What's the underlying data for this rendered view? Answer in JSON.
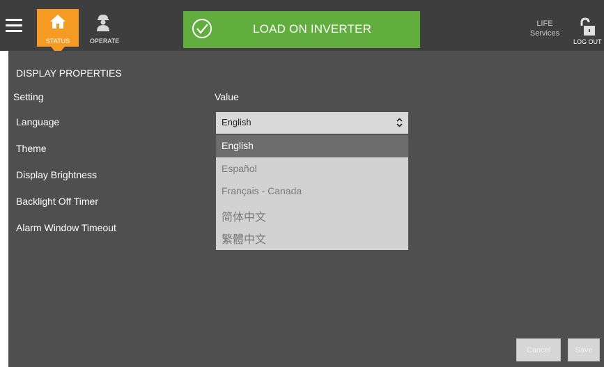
{
  "nav": {
    "status_label": "STATUS",
    "operate_label": "OPERATE",
    "active_color": "#f59a22"
  },
  "banner": {
    "text": "LOAD ON INVERTER",
    "color": "#61ad3d"
  },
  "header_right": {
    "life_line1": "LIFE",
    "life_line2": "Services",
    "logout_label": "LOG OUT"
  },
  "main": {
    "section_title": "DISPLAY PROPERTIES",
    "col_setting": "Setting",
    "col_value": "Value",
    "rows": [
      {
        "label": "Language"
      },
      {
        "label": "Theme"
      },
      {
        "label": "Display Brightness"
      },
      {
        "label": "Backlight Off Timer"
      },
      {
        "label": "Alarm Window Timeout"
      }
    ],
    "language_select": {
      "selected": "English",
      "options": [
        "English",
        "Español",
        "Français - Canada",
        "简体中文",
        "繁體中文"
      ]
    },
    "cancel_label": "Cancel",
    "save_label": "Save"
  },
  "icons": {
    "menu": "hamburger-icon",
    "status": "home-icon",
    "operate": "operator-icon",
    "banner": "check-circle-icon",
    "logout": "padlock-open-icon",
    "select": "up-down-chevron-icon"
  }
}
